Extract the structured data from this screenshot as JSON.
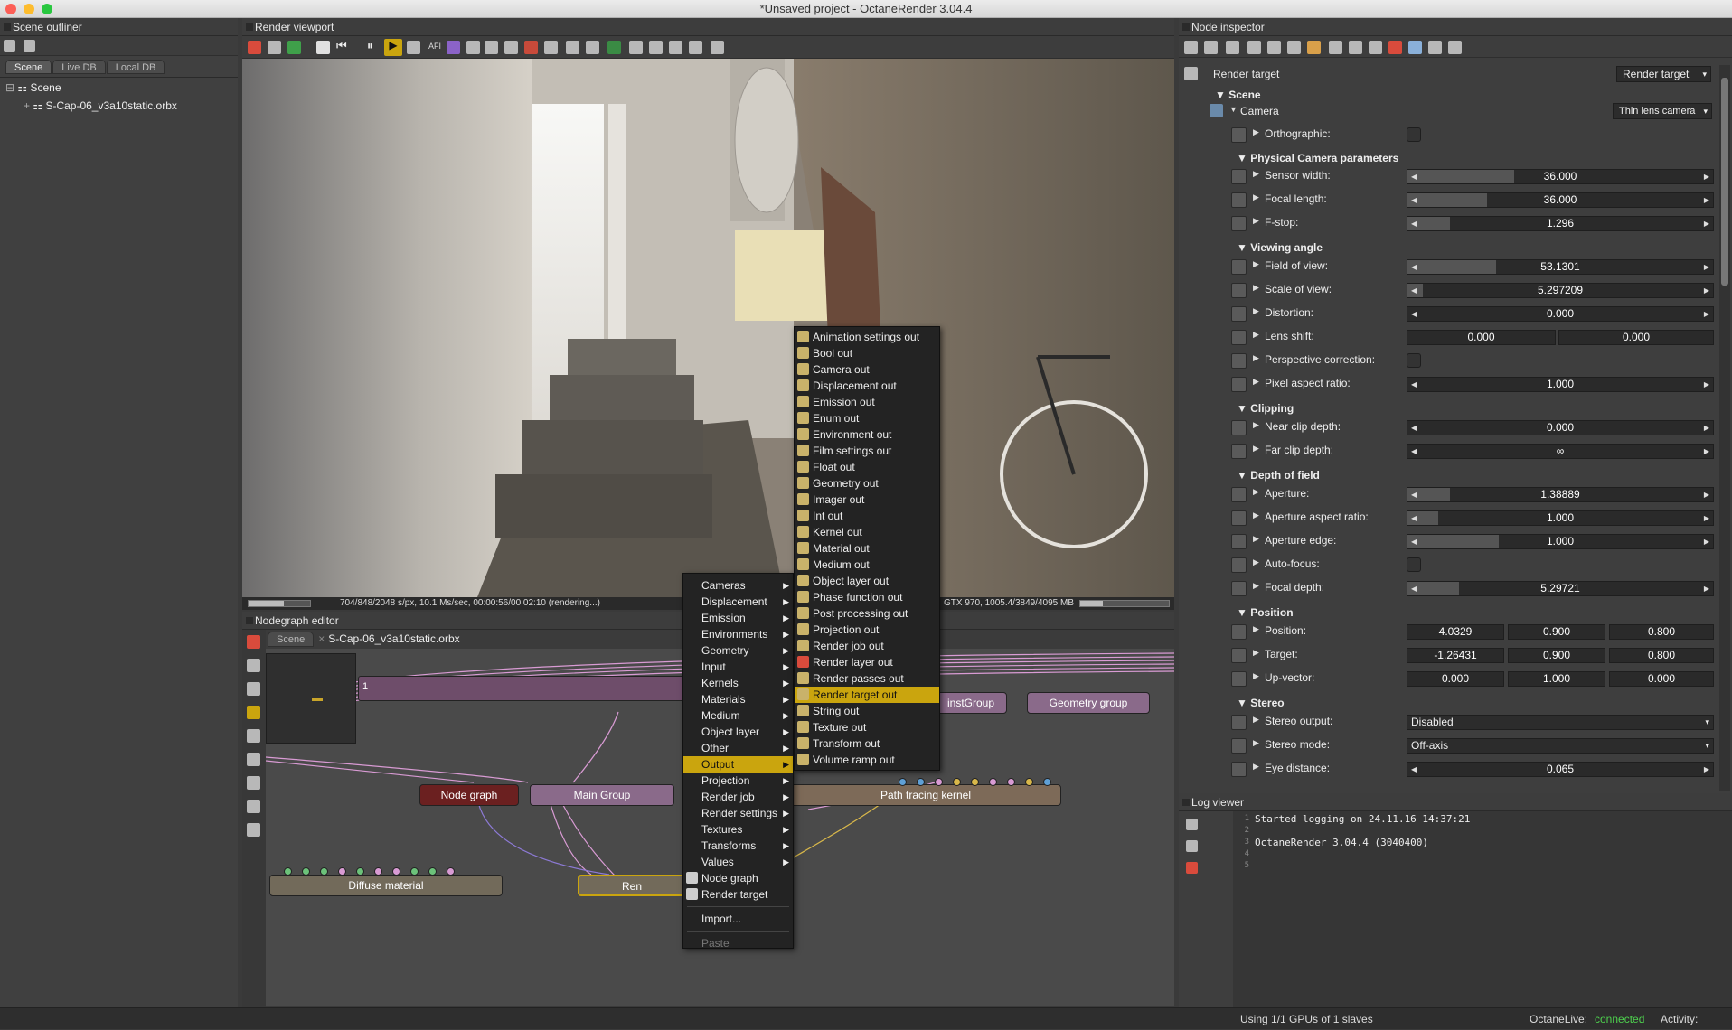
{
  "window": {
    "title": "*Unsaved project - OctaneRender 3.04.4"
  },
  "outliner": {
    "title": "Scene outliner",
    "tabs": [
      "Scene",
      "Live DB",
      "Local DB"
    ],
    "tree": {
      "root": "Scene",
      "child": "S-Cap-06_v3a10static.orbx"
    }
  },
  "viewport": {
    "title": "Render viewport",
    "render_status": "704/848/2048 s/px, 10.1 Ms/sec, 00:00:56/00:02:10 (rendering...)",
    "gpu_status": "GTX 970, 1005.4/3849/4095 MB"
  },
  "nodegraph": {
    "title": "Nodegraph editor",
    "tabs": [
      "Scene",
      "S-Cap-06_v3a10static.orbx"
    ],
    "minimap_label": "1",
    "nodes": {
      "node_graph": "Node graph",
      "main_group": "Main Group",
      "path_tracing": "Path tracing kernel",
      "inst_group": "instGroup",
      "geometry_group": "Geometry group",
      "diffuse": "Diffuse material",
      "render_partial": "Ren"
    }
  },
  "context_menu": {
    "items": [
      "Cameras",
      "Displacement",
      "Emission",
      "Environments",
      "Geometry",
      "Input",
      "Kernels",
      "Materials",
      "Medium",
      "Object layer",
      "Other",
      "Output",
      "Projection",
      "Render job",
      "Render settings",
      "Textures",
      "Transforms",
      "Values"
    ],
    "highlighted": "Output",
    "extra": [
      "Node graph",
      "Render target"
    ],
    "import": "Import...",
    "paste": "Paste"
  },
  "output_submenu": {
    "items": [
      "Animation settings out",
      "Bool out",
      "Camera out",
      "Displacement out",
      "Emission out",
      "Enum out",
      "Environment out",
      "Film settings out",
      "Float out",
      "Geometry out",
      "Imager out",
      "Int out",
      "Kernel out",
      "Material out",
      "Medium out",
      "Object layer out",
      "Phase function out",
      "Post processing out",
      "Projection out",
      "Render job out",
      "Render layer out",
      "Render passes out",
      "Render target out",
      "String out",
      "Texture out",
      "Transform out",
      "Volume ramp out"
    ],
    "highlighted": "Render target out"
  },
  "inspector": {
    "title": "Node inspector",
    "header": "Render target",
    "header_dropdown": "Render target",
    "scene": "Scene",
    "camera": "Camera",
    "camera_type": "Thin lens camera",
    "orthographic": "Orthographic:",
    "sec_physical": "Physical Camera parameters",
    "sensor_width": {
      "label": "Sensor width:",
      "value": "36.000"
    },
    "focal_length": {
      "label": "Focal length:",
      "value": "36.000"
    },
    "fstop": {
      "label": "F-stop:",
      "value": "1.296"
    },
    "sec_viewing": "Viewing angle",
    "fov": {
      "label": "Field of view:",
      "value": "53.1301"
    },
    "scale_view": {
      "label": "Scale of view:",
      "value": "5.297209"
    },
    "distortion": {
      "label": "Distortion:",
      "value": "0.000"
    },
    "lens_shift": {
      "label": "Lens shift:",
      "v1": "0.000",
      "v2": "0.000"
    },
    "perspective": "Perspective correction:",
    "pixel_aspect": {
      "label": "Pixel aspect ratio:",
      "value": "1.000"
    },
    "sec_clipping": "Clipping",
    "near_clip": {
      "label": "Near clip depth:",
      "value": "0.000"
    },
    "far_clip": {
      "label": "Far clip depth:",
      "value": "∞"
    },
    "sec_dof": "Depth of field",
    "aperture": {
      "label": "Aperture:",
      "value": "1.38889"
    },
    "aperture_aspect": {
      "label": "Aperture aspect ratio:",
      "value": "1.000"
    },
    "aperture_edge": {
      "label": "Aperture edge:",
      "value": "1.000"
    },
    "autofocus": "Auto-focus:",
    "focal_depth": {
      "label": "Focal depth:",
      "value": "5.29721"
    },
    "sec_position": "Position",
    "position": {
      "label": "Position:",
      "x": "4.0329",
      "y": "0.900",
      "z": "0.800"
    },
    "target": {
      "label": "Target:",
      "x": "-1.26431",
      "y": "0.900",
      "z": "0.800"
    },
    "up_vector": {
      "label": "Up-vector:",
      "x": "0.000",
      "y": "1.000",
      "z": "0.000"
    },
    "sec_stereo": "Stereo",
    "stereo_output": {
      "label": "Stereo output:",
      "value": "Disabled"
    },
    "stereo_mode": {
      "label": "Stereo mode:",
      "value": "Off-axis"
    },
    "eye_distance": {
      "label": "Eye distance:",
      "value": "0.065"
    }
  },
  "log": {
    "title": "Log viewer",
    "lines": [
      "Started logging on 24.11.16 14:37:21",
      "",
      "OctaneRender 3.04.4 (3040400)",
      "",
      ""
    ]
  },
  "statusbar": {
    "gpus": "Using 1/1 GPUs of 1 slaves",
    "live_label": "OctaneLive:",
    "live_value": "connected",
    "activity": "Activity:"
  },
  "colors": {
    "menu_highlight": "#caa50e",
    "connected": "#4ed14e",
    "node_dark_red": "#6b2020",
    "wire_pink": "#d99bd4"
  }
}
